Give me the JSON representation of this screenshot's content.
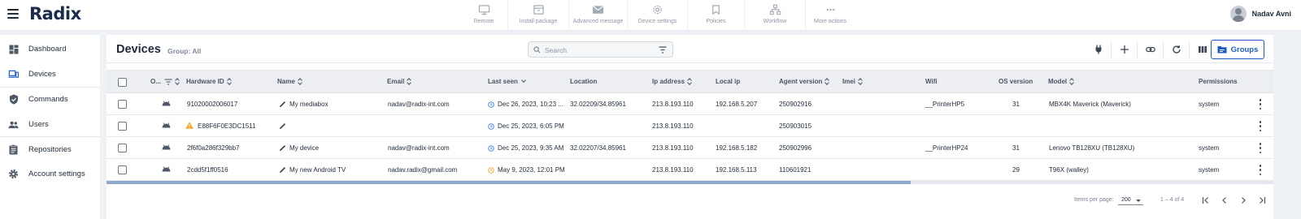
{
  "app": {
    "logo": "Radix",
    "user_name": "Nadav Avni"
  },
  "toolbar": {
    "actions": [
      {
        "label": "Remote",
        "icon": "monitor-icon"
      },
      {
        "label": "Install package",
        "icon": "package-icon"
      },
      {
        "label": "Advanced message",
        "icon": "mail-icon"
      },
      {
        "label": "Device settings",
        "icon": "gear-icon"
      },
      {
        "label": "Policies",
        "icon": "bookmark-icon"
      },
      {
        "label": "Workflow",
        "icon": "workflow-icon"
      },
      {
        "label": "More actions",
        "icon": "dots-icon"
      }
    ]
  },
  "sidebar": {
    "items": [
      {
        "label": "Dashboard",
        "icon": "dashboard-icon"
      },
      {
        "label": "Devices",
        "icon": "devices-icon"
      },
      {
        "label": "Commands",
        "icon": "shield-icon"
      },
      {
        "label": "Users",
        "icon": "users-icon"
      },
      {
        "label": "Repositories",
        "icon": "clipboard-icon"
      },
      {
        "label": "Account settings",
        "icon": "gear-icon"
      }
    ]
  },
  "page": {
    "title": "Devices",
    "group": "Group: All",
    "search_placeholder": "Search",
    "groups_button": "Groups"
  },
  "table": {
    "columns": {
      "os": "O...",
      "hardware_id": "Hardware ID",
      "name": "Name",
      "email": "Email",
      "last_seen": "Last seen",
      "location": "Location",
      "ip": "Ip address",
      "local_ip": "Local ip",
      "agent": "Agent version",
      "imei": "Imei",
      "wifi": "Wifi",
      "os_version": "OS version",
      "model": "Model",
      "permissions": "Permissions"
    },
    "rows": [
      {
        "hardware_id": "91020002006017",
        "name": "My mediabox",
        "email": "nadav@radix-int.com",
        "last_seen": "Dec 26, 2023, 10:23 ...",
        "location": "32.02209/34.85961",
        "ip": "213.8.193.110",
        "local_ip": "192.168.5.207",
        "agent": "250902916",
        "imei": "",
        "wifi": "__PrinterHP5",
        "os_version": "31",
        "model": "MBX4K Maverick (Maverick)",
        "permissions": "system",
        "warning": false
      },
      {
        "hardware_id": "E88F6F0E3DC1511",
        "name": "",
        "email": "",
        "last_seen": "Dec 25, 2023, 6:05 PM",
        "location": "",
        "ip": "213.8.193.110",
        "local_ip": "",
        "agent": "250903015",
        "imei": "",
        "wifi": "",
        "os_version": "",
        "model": "",
        "permissions": "",
        "warning": true
      },
      {
        "hardware_id": "2f6f0a286f329bb7",
        "name": "My device",
        "email": "nadav@radix-int.com",
        "last_seen": "Dec 25, 2023, 9:35 AM",
        "location": "32.02207/34.85961",
        "ip": "213.8.193.110",
        "local_ip": "192.168.5.182",
        "agent": "250902996",
        "imei": "",
        "wifi": "__PrinterHP24",
        "os_version": "31",
        "model": "Lenovo TB128XU (TB128XU)",
        "permissions": "system",
        "warning": false
      },
      {
        "hardware_id": "2cdd5f1ff0516",
        "name": "My new Android TV",
        "email": "nadav.radix@gmail.com",
        "last_seen": "May 9, 2023, 12:01 PM",
        "location": "",
        "ip": "213.8.193.110",
        "local_ip": "192.168.5.113",
        "agent": "110601921",
        "imei": "",
        "wifi": "",
        "os_version": "29",
        "model": "T96X (walley)",
        "permissions": "system",
        "warning": false
      }
    ]
  },
  "pagination": {
    "items_per_page_label": "Items per page:",
    "items_per_page": "200",
    "range": "1 – 4 of 4"
  },
  "colors": {
    "accent": "#1c5bc5",
    "warning": "#f5a623",
    "clock_recent": "#3b82f6",
    "clock_old": "#f5a623"
  }
}
